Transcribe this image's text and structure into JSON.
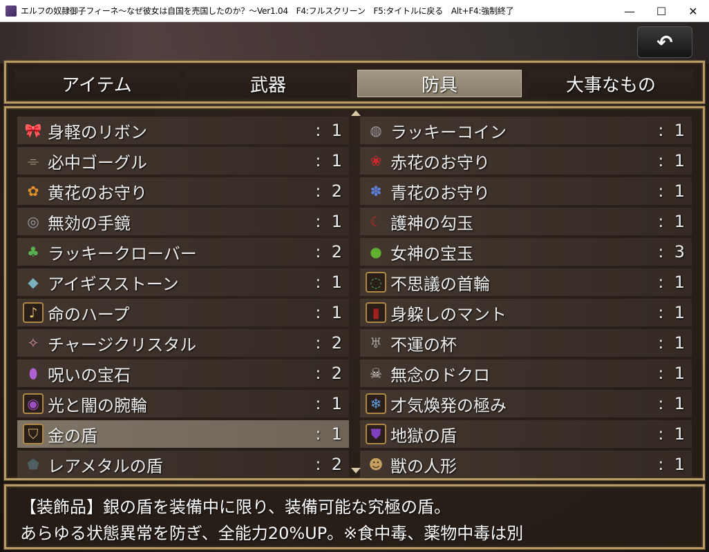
{
  "window": {
    "title": "エルフの奴隷御子フィーネ～なぜ彼女は自国を売国したのか？～Ver1.04　F4:フルスクリーン　F5:タイトルに戻る　Alt+F4:強制終了",
    "minimize": "—",
    "maximize": "☐",
    "close": "✕"
  },
  "back_button": {
    "glyph": "↶"
  },
  "tabs": [
    {
      "label": "アイテム"
    },
    {
      "label": "武器"
    },
    {
      "label": "防具"
    },
    {
      "label": "大事なもの"
    }
  ],
  "selected_tab": 2,
  "items_left": [
    {
      "name": "身軽のリボン",
      "count": ":  1",
      "icon": "ribbon-icon",
      "glyph": "🎀"
    },
    {
      "name": "必中ゴーグル",
      "count": ":  1",
      "icon": "goggles-icon",
      "glyph": "⌯"
    },
    {
      "name": "黄花のお守り",
      "count": ":  2",
      "icon": "yellow-flower-icon",
      "glyph": "✿"
    },
    {
      "name": "無効の手鏡",
      "count": ":  1",
      "icon": "mirror-icon",
      "glyph": "◎"
    },
    {
      "name": "ラッキークローバー",
      "count": ":  2",
      "icon": "clover-icon",
      "glyph": "♣"
    },
    {
      "name": "アイギスストーン",
      "count": ":  1",
      "icon": "stone-icon",
      "glyph": "◆"
    },
    {
      "name": "命のハープ",
      "count": ":  1",
      "icon": "harp-icon",
      "glyph": "♪"
    },
    {
      "name": "チャージクリスタル",
      "count": ":  2",
      "icon": "crystal-icon",
      "glyph": "✧"
    },
    {
      "name": "呪いの宝石",
      "count": ":  2",
      "icon": "cursed-gem-icon",
      "glyph": "⬮"
    },
    {
      "name": "光と闇の腕輪",
      "count": ":  1",
      "icon": "bracelet-icon",
      "glyph": "◉"
    },
    {
      "name": "金の盾",
      "count": ":  1",
      "icon": "gold-shield-icon",
      "glyph": "⛉"
    },
    {
      "name": "レアメタルの盾",
      "count": ":  2",
      "icon": "metal-shield-icon",
      "glyph": "⬟"
    }
  ],
  "items_right": [
    {
      "name": "ラッキーコイン",
      "count": ":  1",
      "icon": "coin-icon",
      "glyph": "◍"
    },
    {
      "name": "赤花のお守り",
      "count": ":  1",
      "icon": "red-flower-icon",
      "glyph": "❀"
    },
    {
      "name": "青花のお守り",
      "count": ":  1",
      "icon": "blue-flower-icon",
      "glyph": "✽"
    },
    {
      "name": "護神の勾玉",
      "count": ":  1",
      "icon": "magatama-icon",
      "glyph": "☾"
    },
    {
      "name": "女神の宝玉",
      "count": ":  3",
      "icon": "orb-icon",
      "glyph": "●"
    },
    {
      "name": "不思議の首輪",
      "count": ":  1",
      "icon": "necklace-icon",
      "glyph": "◌"
    },
    {
      "name": "身躱しのマント",
      "count": ":  1",
      "icon": "cloak-icon",
      "glyph": "▮"
    },
    {
      "name": "不運の杯",
      "count": ":  1",
      "icon": "cup-icon",
      "glyph": "♅"
    },
    {
      "name": "無念のドクロ",
      "count": ":  1",
      "icon": "skull-icon",
      "glyph": "☠"
    },
    {
      "name": "才気煥発の極み",
      "count": ":  1",
      "icon": "snowflake-icon",
      "glyph": "❄"
    },
    {
      "name": "地獄の盾",
      "count": ":  1",
      "icon": "hell-shield-icon",
      "glyph": "⛊"
    },
    {
      "name": "獣の人形",
      "count": ":  1",
      "icon": "doll-icon",
      "glyph": "☻"
    }
  ],
  "selected_item": "金の盾",
  "help": {
    "line1": "【装飾品】銀の盾を装備中に限り、装備可能な究極の盾。",
    "line2": "あらゆる状態異常を防ぎ、全能力20%UP。※食中毒、薬物中毒は別"
  },
  "colors": {
    "frame": "#b89a66",
    "selected_tab": "#a29784",
    "selected_row": "#7e7466"
  }
}
